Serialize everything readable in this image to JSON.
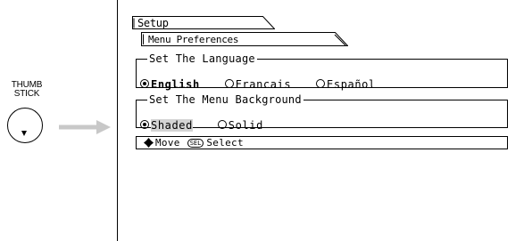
{
  "illustration": {
    "label_line1": "THUMB",
    "label_line2": "STICK",
    "arrow_color": "#c8c8c8"
  },
  "screen": {
    "setup_tab": "Setup",
    "prefs_tab": "Menu Preferences",
    "language": {
      "legend": "Set The Language",
      "options": [
        {
          "label": "English",
          "selected": true
        },
        {
          "label": "Francais",
          "selected": false
        },
        {
          "label": "Español",
          "selected": false
        }
      ]
    },
    "background": {
      "legend": "Set The Menu Background",
      "options": [
        {
          "label": "Shaded",
          "selected": true
        },
        {
          "label": "Solid",
          "selected": false
        }
      ]
    },
    "status": {
      "move_icon": "dpad-icon",
      "move_label": "Move",
      "sel_badge": "SEL",
      "select_label": "Select"
    }
  }
}
